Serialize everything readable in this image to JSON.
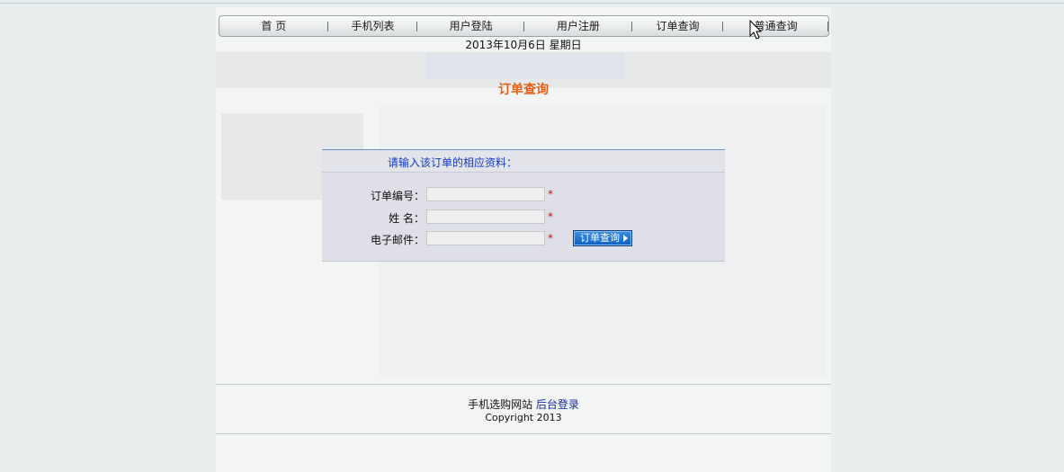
{
  "nav": {
    "items": [
      "首 页",
      "手机列表",
      "用户登陆",
      "用户注册",
      "订单查询",
      "普通查询"
    ]
  },
  "date_text": "2013年10月6日  星期日",
  "page_title": "订单查询",
  "form": {
    "heading": "请输入该订单的相应资料：",
    "fields": [
      {
        "label": "订单编号：",
        "value": ""
      },
      {
        "label": "姓  名：",
        "value": ""
      },
      {
        "label": "电子邮件：",
        "value": ""
      }
    ],
    "required_mark": "*",
    "submit_label": "订单查询"
  },
  "footer": {
    "site_name": "手机选购网站",
    "admin_link": "后台登录",
    "copyright": "Copyright 2013"
  },
  "colors": {
    "title": "#e35f12",
    "heading": "#1238c4",
    "button": "#0e5fc0",
    "required": "#c4121d"
  }
}
